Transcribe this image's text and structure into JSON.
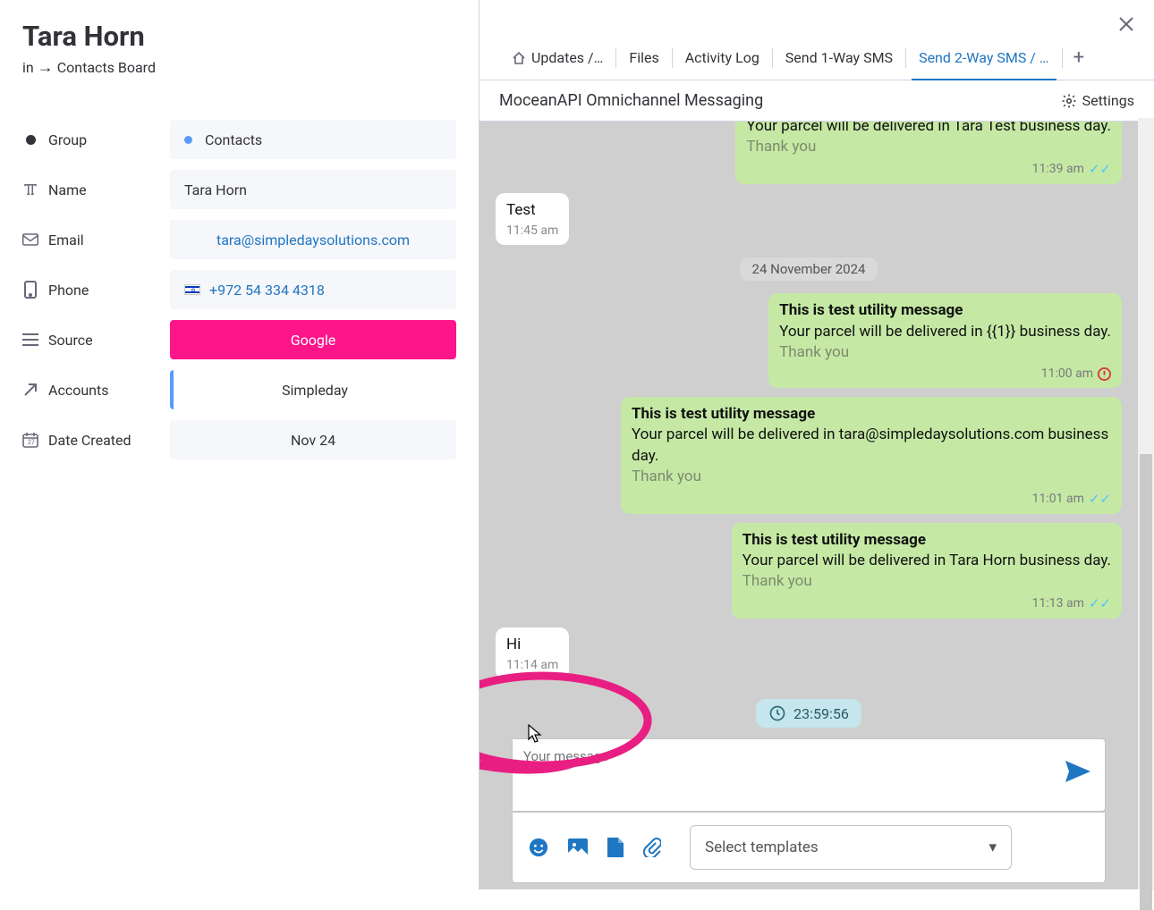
{
  "header": {
    "title": "Tara Horn",
    "breadcrumb_prefix": "in",
    "breadcrumb_target": "Contacts Board"
  },
  "fields": {
    "group_label": "Group",
    "group_value": "Contacts",
    "name_label": "Name",
    "name_value": "Tara Horn",
    "email_label": "Email",
    "email_value": "tara@simpledaysolutions.com",
    "phone_label": "Phone",
    "phone_value": "+972 54 334 4318",
    "source_label": "Source",
    "source_value": "Google",
    "accounts_label": "Accounts",
    "accounts_value": "Simpleday",
    "date_created_label": "Date Created",
    "date_created_value": "Nov 24"
  },
  "tabs": {
    "updates": "Updates /…",
    "files": "Files",
    "activity": "Activity Log",
    "send1way": "Send 1-Way SMS",
    "send2way": "Send 2-Way SMS / …"
  },
  "sub_header": {
    "title": "MoceanAPI Omnichannel Messaging",
    "settings": "Settings"
  },
  "chat": {
    "msg0_body": "Your parcel will be delivered in Tara Test business day.",
    "msg0_thanks": "Thank you",
    "msg0_time": "11:39 am",
    "msg1_body": "Test",
    "msg1_time": "11:45 am",
    "date_sep": "24 November 2024",
    "msg2_title": "This is test utility message",
    "msg2_body": "Your parcel will be delivered in {{1}} business day.",
    "msg2_thanks": "Thank you",
    "msg2_time": "11:00 am",
    "msg3_title": "This is test utility message",
    "msg3_body": "Your parcel will be delivered in tara@simpledaysolutions.com business day.",
    "msg3_thanks": "Thank you",
    "msg3_time": "11:01 am",
    "msg4_title": "This is test utility message",
    "msg4_body": "Your parcel will be delivered in Tara Horn business day.",
    "msg4_thanks": "Thank you",
    "msg4_time": "11:13 am",
    "msg5_body": "Hi",
    "msg5_time": "11:14 am",
    "timer": "23:59:56"
  },
  "composer": {
    "placeholder": "Your message",
    "template_placeholder": "Select templates"
  }
}
